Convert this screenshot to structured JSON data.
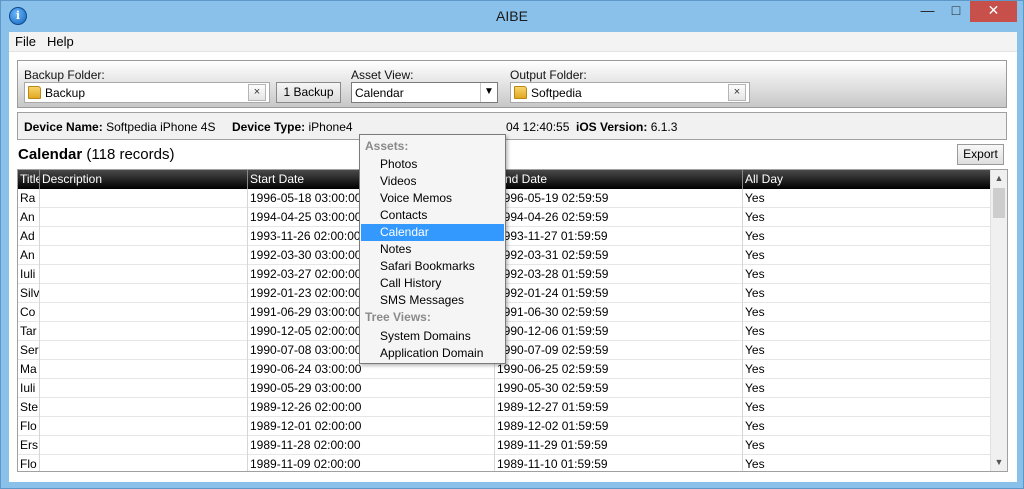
{
  "window": {
    "title": "AIBE",
    "minimize": "—",
    "maximize": "□",
    "close": "✕"
  },
  "menu": [
    "File",
    "Help"
  ],
  "toolbar": {
    "backup_folder_label": "Backup Folder:",
    "backup_folder_value": "Backup",
    "backup_count_button": "1 Backup",
    "asset_view_label": "Asset View:",
    "asset_view_value": "Calendar",
    "output_folder_label": "Output Folder:",
    "output_folder_value": "Softpedia",
    "clear_glyph": "×"
  },
  "device_info": {
    "name_label": "Device Name:",
    "name_value": "Softpedia iPhone 4S",
    "type_label": "Device Type:",
    "type_value": "iPhone4",
    "date_fragment": "04 12:40:55",
    "ios_label": "iOS Version:",
    "ios_value": "6.1.3"
  },
  "records": {
    "title": "Calendar",
    "count_text": "(118 records)",
    "export_button": "Export"
  },
  "grid": {
    "columns": [
      "Title",
      "Description",
      "Start Date",
      "End Date",
      "All Day"
    ],
    "rows": [
      [
        "Ra",
        "",
        "1996-05-18 03:00:00",
        "1996-05-19 02:59:59",
        "Yes"
      ],
      [
        "An",
        "",
        "1994-04-25 03:00:00",
        "1994-04-26 02:59:59",
        "Yes"
      ],
      [
        "Ad",
        "",
        "1993-11-26 02:00:00",
        "1993-11-27 01:59:59",
        "Yes"
      ],
      [
        "An",
        "",
        "1992-03-30 03:00:00",
        "1992-03-31 02:59:59",
        "Yes"
      ],
      [
        "Iuli",
        "",
        "1992-03-27 02:00:00",
        "1992-03-28 01:59:59",
        "Yes"
      ],
      [
        "Silv",
        "",
        "1992-01-23 02:00:00",
        "1992-01-24 01:59:59",
        "Yes"
      ],
      [
        "Co",
        "",
        "1991-06-29 03:00:00",
        "1991-06-30 02:59:59",
        "Yes"
      ],
      [
        "Tar",
        "",
        "1990-12-05 02:00:00",
        "1990-12-06 01:59:59",
        "Yes"
      ],
      [
        "Ser",
        "",
        "1990-07-08 03:00:00",
        "1990-07-09 02:59:59",
        "Yes"
      ],
      [
        "Ma",
        "",
        "1990-06-24 03:00:00",
        "1990-06-25 02:59:59",
        "Yes"
      ],
      [
        "Iuli",
        "",
        "1990-05-29 03:00:00",
        "1990-05-30 02:59:59",
        "Yes"
      ],
      [
        "Ste",
        "",
        "1989-12-26 02:00:00",
        "1989-12-27 01:59:59",
        "Yes"
      ],
      [
        "Flo",
        "",
        "1989-12-01 02:00:00",
        "1989-12-02 01:59:59",
        "Yes"
      ],
      [
        "Ers",
        "",
        "1989-11-28 02:00:00",
        "1989-11-29 01:59:59",
        "Yes"
      ],
      [
        "Flo",
        "",
        "1989-11-09 02:00:00",
        "1989-11-10 01:59:59",
        "Yes"
      ]
    ]
  },
  "scroll": {
    "up_glyph": "▲",
    "down_glyph": "▼"
  },
  "dropdown": {
    "assets_header": "Assets:",
    "assets": [
      "Photos",
      "Videos",
      "Voice Memos",
      "Contacts",
      "Calendar",
      "Notes",
      "Safari Bookmarks",
      "Call History",
      "SMS Messages"
    ],
    "selected": "Calendar",
    "tree_header": "Tree Views:",
    "tree_views": [
      "System Domains",
      "Application Domain"
    ],
    "arrow_glyph": "▼"
  },
  "colors": {
    "selection": "#3399ff",
    "header_bg": "#000000",
    "window_frame": "#8ac1ea"
  },
  "icons": {
    "app": "info-icon",
    "folder": "folder-icon"
  }
}
